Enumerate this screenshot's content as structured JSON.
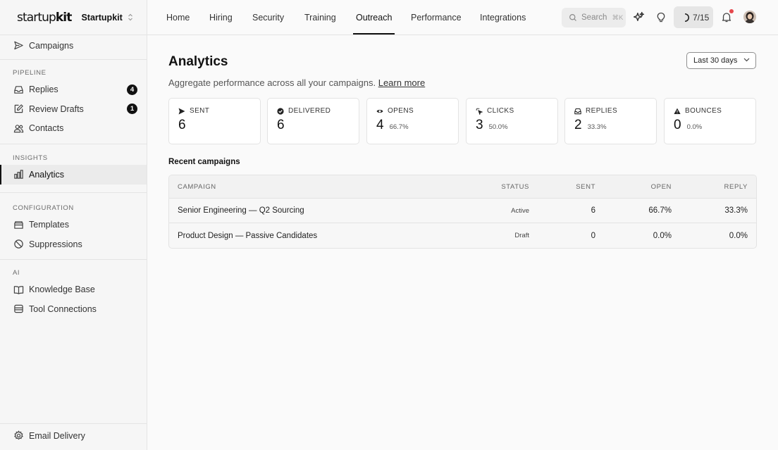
{
  "brand": {
    "logo_light": "startup",
    "logo_bold": "kit",
    "workspace": "Startupkit"
  },
  "topnav": {
    "tabs": [
      {
        "label": "Home"
      },
      {
        "label": "Hiring"
      },
      {
        "label": "Security"
      },
      {
        "label": "Training"
      },
      {
        "label": "Outreach",
        "active": true
      },
      {
        "label": "Performance"
      },
      {
        "label": "Integrations"
      }
    ],
    "search_placeholder": "Search",
    "search_shortcut": "⌘K",
    "progress": "7/15"
  },
  "sidebar": {
    "top_item": "Campaigns",
    "pipeline_label": "PIPELINE",
    "pipeline": [
      {
        "label": "Replies",
        "badge": "4"
      },
      {
        "label": "Review Drafts",
        "badge": "1"
      },
      {
        "label": "Contacts"
      }
    ],
    "insights_label": "INSIGHTS",
    "insights": [
      {
        "label": "Analytics",
        "active": true
      }
    ],
    "configuration_label": "CONFIGURATION",
    "configuration": [
      {
        "label": "Templates"
      },
      {
        "label": "Suppressions"
      }
    ],
    "ai_label": "AI",
    "ai": [
      {
        "label": "Knowledge Base"
      },
      {
        "label": "Tool Connections"
      }
    ],
    "footer_item": "Email Delivery"
  },
  "page": {
    "title": "Analytics",
    "subtitle": "Aggregate performance across all your campaigns.",
    "learn_more": "Learn more",
    "date_range": "Last 30 days"
  },
  "stats": [
    {
      "label": "SENT",
      "value": "6",
      "pct": "",
      "icon": "send-icon"
    },
    {
      "label": "DELIVERED",
      "value": "6",
      "pct": "",
      "icon": "check-circle-icon"
    },
    {
      "label": "OPENS",
      "value": "4",
      "pct": "66.7%",
      "icon": "eye-icon"
    },
    {
      "label": "CLICKS",
      "value": "3",
      "pct": "50.0%",
      "icon": "pointer-click-icon"
    },
    {
      "label": "REPLIES",
      "value": "2",
      "pct": "33.3%",
      "icon": "inbox-icon"
    },
    {
      "label": "BOUNCES",
      "value": "0",
      "pct": "0.0%",
      "icon": "warning-icon"
    }
  ],
  "recent": {
    "heading": "Recent campaigns",
    "columns": {
      "campaign": "CAMPAIGN",
      "status": "STATUS",
      "sent": "SENT",
      "open": "OPEN",
      "reply": "REPLY"
    },
    "rows": [
      {
        "campaign": "Senior Engineering — Q2 Sourcing",
        "status": "Active",
        "sent": "6",
        "open": "66.7%",
        "reply": "33.3%"
      },
      {
        "campaign": "Product Design — Passive Candidates",
        "status": "Draft",
        "sent": "0",
        "open": "0.0%",
        "reply": "0.0%"
      }
    ]
  }
}
